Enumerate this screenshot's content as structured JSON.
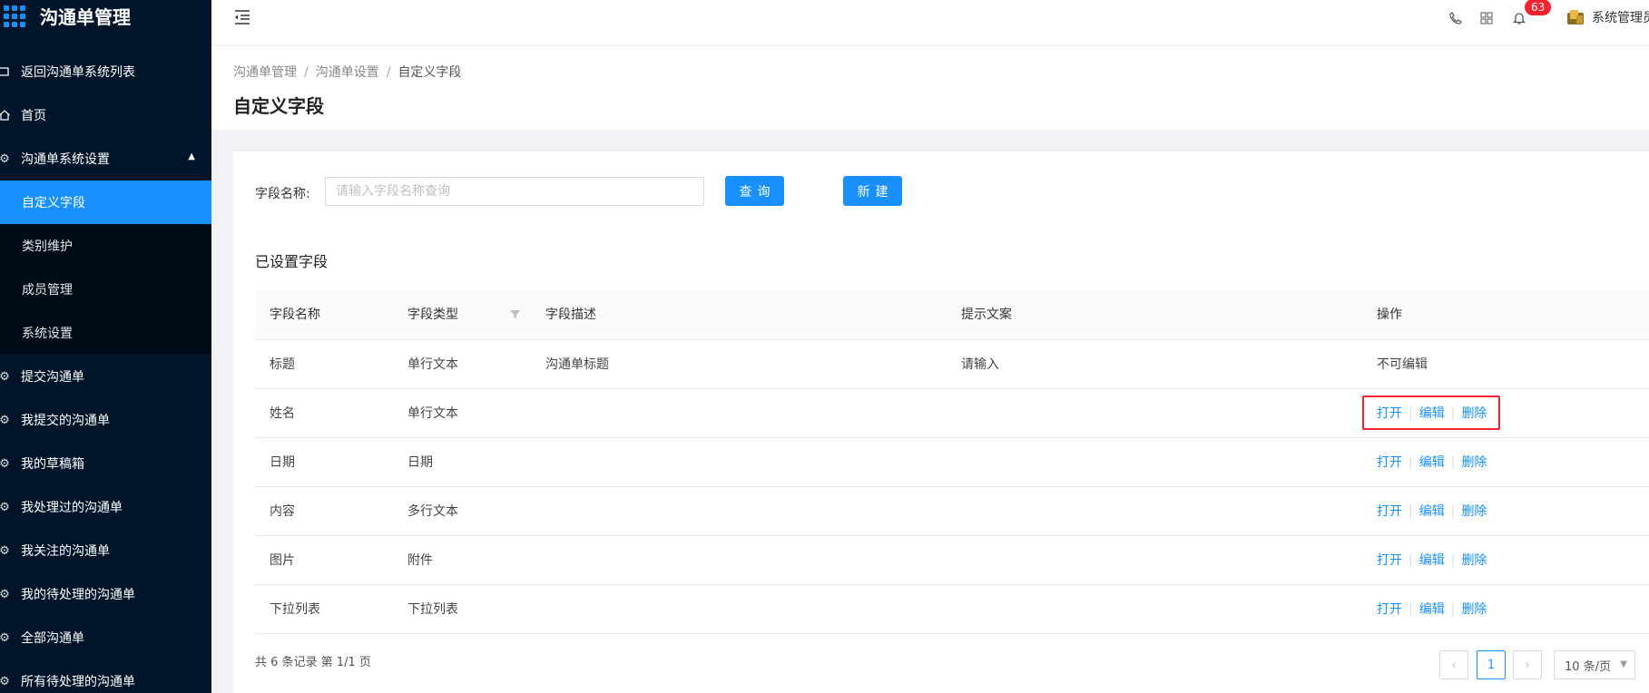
{
  "app": {
    "title": "沟通单管理"
  },
  "sidebar": {
    "items": [
      {
        "label": "返回沟通单系统列表",
        "icon": "back-icon"
      },
      {
        "label": "首页",
        "icon": "home-icon"
      },
      {
        "label": "沟通单系统设置",
        "icon": "gear-icon",
        "expanded": true,
        "children": [
          {
            "label": "自定义字段",
            "active": true
          },
          {
            "label": "类别维护"
          },
          {
            "label": "成员管理"
          },
          {
            "label": "系统设置"
          }
        ]
      },
      {
        "label": "提交沟通单",
        "icon": "gear-icon"
      },
      {
        "label": "我提交的沟通单",
        "icon": "gear-icon"
      },
      {
        "label": "我的草稿箱",
        "icon": "gear-icon"
      },
      {
        "label": "我处理过的沟通单",
        "icon": "gear-icon"
      },
      {
        "label": "我关注的沟通单",
        "icon": "gear-icon"
      },
      {
        "label": "我的待处理的沟通单",
        "icon": "gear-icon"
      },
      {
        "label": "全部沟通单",
        "icon": "gear-icon"
      },
      {
        "label": "所有待处理的沟通单",
        "icon": "gear-icon"
      }
    ]
  },
  "header": {
    "notification_count": "63",
    "user_name": "系统管理员"
  },
  "breadcrumb": [
    "沟通单管理",
    "沟通单设置",
    "自定义字段"
  ],
  "page_title": "自定义字段",
  "filter": {
    "label": "字段名称:",
    "placeholder": "请输入字段名称查询",
    "value": "",
    "search_label": "查询",
    "new_label": "新建"
  },
  "section_title": "已设置字段",
  "table": {
    "columns": [
      "字段名称",
      "字段类型",
      "字段描述",
      "提示文案",
      "操作"
    ],
    "rows": [
      {
        "name": "标题",
        "type": "单行文本",
        "desc": "沟通单标题",
        "hint": "请输入",
        "op_text": "不可编辑"
      },
      {
        "name": "姓名",
        "type": "单行文本",
        "desc": "",
        "hint": ""
      },
      {
        "name": "日期",
        "type": "日期",
        "desc": "",
        "hint": ""
      },
      {
        "name": "内容",
        "type": "多行文本",
        "desc": "",
        "hint": ""
      },
      {
        "name": "图片",
        "type": "附件",
        "desc": "",
        "hint": ""
      },
      {
        "name": "下拉列表",
        "type": "下拉列表",
        "desc": "",
        "hint": ""
      }
    ],
    "actions": {
      "open": "打开",
      "edit": "编辑",
      "delete": "删除"
    }
  },
  "pagination": {
    "summary": "共 6 条记录 第 1/1 页",
    "current_page": "1",
    "page_size": "10 条/页"
  },
  "colors": {
    "primary": "#1890ff",
    "sidebar_bg": "#001529",
    "badge": "#f5222d",
    "highlight": "#f5222d"
  }
}
